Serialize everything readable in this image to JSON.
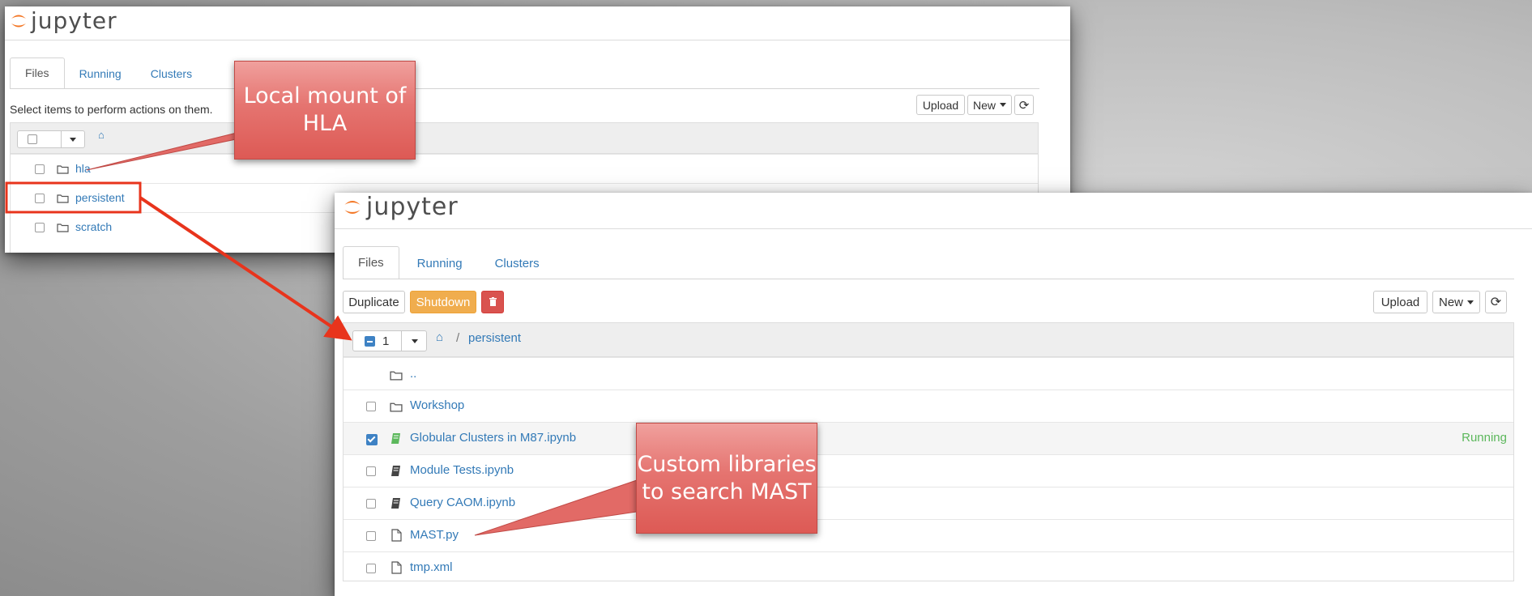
{
  "window1": {
    "logo_text": "jupyter",
    "tabs": [
      "Files",
      "Running",
      "Clusters"
    ],
    "hint": "Select items to perform actions on them.",
    "upload_label": "Upload",
    "new_label": "New",
    "refresh_icon": "refresh-icon",
    "items": [
      {
        "name": "hla",
        "icon": "folder-icon"
      },
      {
        "name": "persistent",
        "icon": "folder-icon"
      },
      {
        "name": "scratch",
        "icon": "folder-icon"
      }
    ]
  },
  "window2": {
    "logo_text": "jupyter",
    "tabs": [
      "Files",
      "Running",
      "Clusters"
    ],
    "actions": {
      "duplicate": "Duplicate",
      "shutdown": "Shutdown",
      "delete_icon": "trash-icon"
    },
    "upload_label": "Upload",
    "new_label": "New",
    "selected_count": "1",
    "breadcrumb": {
      "separator": "/",
      "current": "persistent"
    },
    "items": [
      {
        "name": "..",
        "icon": "folder-icon",
        "has_checkbox": false
      },
      {
        "name": "Workshop",
        "icon": "folder-icon"
      },
      {
        "name": "Globular Clusters in M87.ipynb",
        "icon": "notebook-icon",
        "checked": true,
        "status": "Running"
      },
      {
        "name": "Module Tests.ipynb",
        "icon": "notebook-icon"
      },
      {
        "name": "Query CAOM.ipynb",
        "icon": "notebook-icon"
      },
      {
        "name": "MAST.py",
        "icon": "file-icon"
      },
      {
        "name": "tmp.xml",
        "icon": "file-icon"
      }
    ]
  },
  "callouts": {
    "local_mount": "Local mount of HLA",
    "custom_libraries": "Custom libraries to search MAST"
  },
  "colors": {
    "link": "#337ab7",
    "running": "#5cb85c",
    "shutdown": "#f0ad4e",
    "delete": "#d9534f",
    "callout": "#e26a66",
    "highlight": "#e8341c"
  }
}
